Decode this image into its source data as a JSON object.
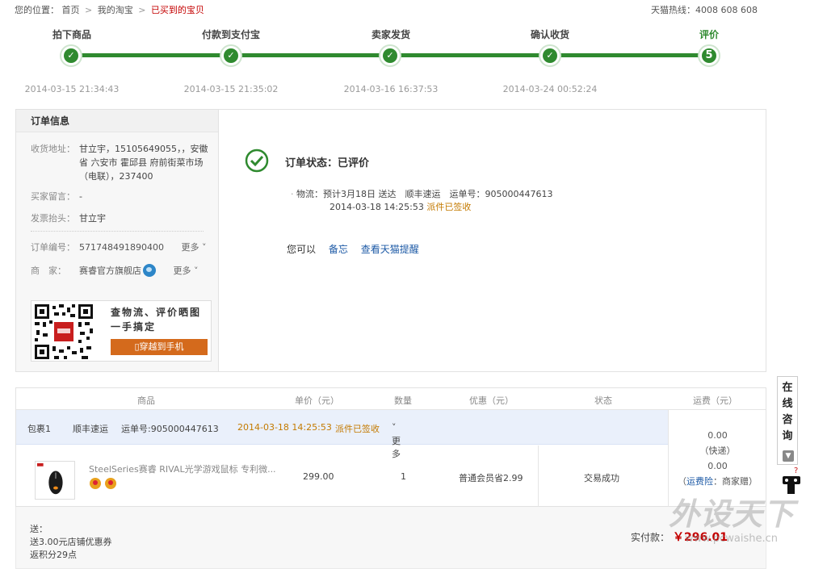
{
  "breadcrumb": {
    "prefix": "您的位置：",
    "home": "首页",
    "my_taobao": "我的淘宝",
    "current": "已买到的宝贝",
    "sep": ">"
  },
  "hotline": "天猫热线：4008 608 608",
  "steps": [
    {
      "label": "拍下商品",
      "time": "2014-03-15 21:34:43",
      "done": true
    },
    {
      "label": "付款到支付宝",
      "time": "2014-03-15 21:35:02",
      "done": true
    },
    {
      "label": "卖家发货",
      "time": "2014-03-16 16:37:53",
      "done": true
    },
    {
      "label": "确认收货",
      "time": "2014-03-24 00:52:24",
      "done": true
    },
    {
      "label": "评价",
      "time": "",
      "done": false,
      "number": "5"
    }
  ],
  "order_info": {
    "title": "订单信息",
    "address_label": "收货地址：",
    "address_value": "甘立宇，15105649055，，安徽省 六安市 霍邱县 府前街菜市场（电联），237400",
    "message_label": "买家留言：",
    "message_value": "-",
    "invoice_label": "发票抬头：",
    "invoice_value": "甘立宇",
    "order_no_label": "订单编号：",
    "order_no_value": "571748491890400",
    "more_label": "更多",
    "seller_label": "商　家：",
    "seller_value": "赛睿官方旗舰店"
  },
  "qr_promo": {
    "text": "查物流、评价晒图一手搞定",
    "button": "穿越到手机"
  },
  "status": {
    "label": "订单状态：已评价",
    "logistics_prefix": "物流：",
    "logistics_text": "预计3月18日 送达　顺丰速运　运单号：905000447613",
    "logistics_time": "2014-03-18 14:25:53",
    "logistics_state": "派件已签收",
    "actions_prefix": "您可以",
    "action_memo": "备忘",
    "action_reminder": "查看天猫提醒"
  },
  "goods_table": {
    "headers": {
      "product": "商品",
      "price": "单价（元）",
      "qty": "数量",
      "discount": "优惠（元）",
      "state": "状态",
      "shipping": "运费（元）"
    },
    "package": {
      "name": "包裹1",
      "carrier": "顺丰速运",
      "waybill": "运单号:905000447613",
      "time": "2014-03-18 14:25:53",
      "state": "派件已签收",
      "more": "更多"
    },
    "item": {
      "title": "SteelSeries赛睿 RIVAL光学游戏鼠标 专利微...",
      "price": "299.00",
      "qty": "1",
      "discount": "普通会员省2.99",
      "state": "交易成功"
    },
    "shipping": {
      "fee": "0.00",
      "type": "（快递）",
      "insurance_fee": "0.00",
      "insurance_link": "运费险",
      "insurance_note": "：商家赠）"
    }
  },
  "footer": {
    "gift_line1": "送：",
    "gift_line2": "送3.00元店铺优惠券",
    "gift_line3": "返积分29点",
    "paid_label": "实付款：",
    "paid_amount": "￥296.01"
  },
  "side_tool": {
    "label_chars": [
      "在",
      "线",
      "咨",
      "询"
    ]
  },
  "watermark": {
    "big": "外设天下",
    "small": "www.pcwaishe.cn"
  },
  "colors": {
    "progress_green": "#2f8a2f",
    "price_red": "#c40000",
    "link_blue": "#1d5aa6",
    "signed_orange": "#c47a00",
    "promo_button": "#d46a1c"
  }
}
